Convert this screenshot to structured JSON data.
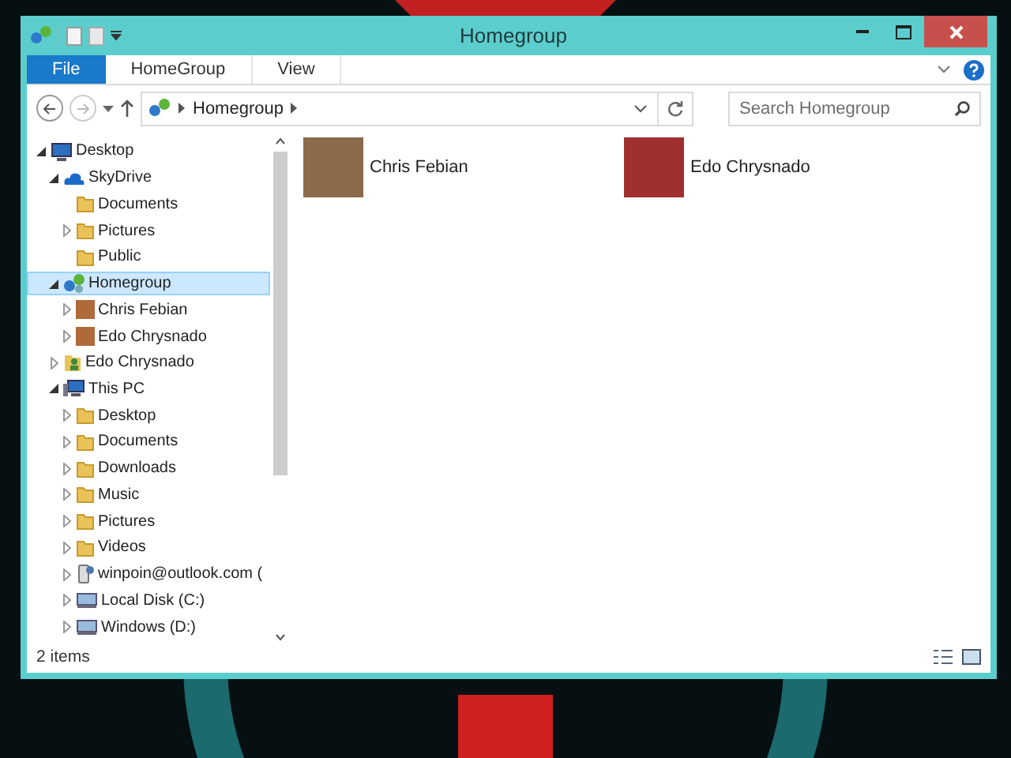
{
  "window": {
    "title": "Homegroup"
  },
  "ribbon": {
    "tabs": [
      {
        "label": "File",
        "kind": "file",
        "selected": false
      },
      {
        "label": "HomeGroup",
        "kind": "tab",
        "selected": false
      },
      {
        "label": "View",
        "kind": "tab",
        "selected": false
      }
    ]
  },
  "address": {
    "path": "Homegroup",
    "search_placeholder": "Search Homegroup"
  },
  "sidebar": {
    "items": [
      {
        "label": "Desktop",
        "kind": "desktop",
        "expandable": true,
        "expanded": true,
        "selected": false,
        "children": [
          {
            "label": "SkyDrive",
            "kind": "cloud",
            "expandable": true,
            "expanded": true,
            "selected": false,
            "children": [
              {
                "label": "Documents",
                "kind": "folder",
                "expandable": false,
                "selected": false
              },
              {
                "label": "Pictures",
                "kind": "folder",
                "expandable": true,
                "expanded": false,
                "selected": false
              },
              {
                "label": "Public",
                "kind": "folder",
                "expandable": false,
                "selected": false
              }
            ]
          },
          {
            "label": "Homegroup",
            "kind": "homegroup",
            "expandable": true,
            "expanded": true,
            "selected": true,
            "children": [
              {
                "label": "Chris Febian",
                "kind": "photo",
                "expandable": true,
                "expanded": false,
                "selected": false
              },
              {
                "label": "Edo Chrysnado",
                "kind": "photo",
                "expandable": true,
                "expanded": false,
                "selected": false
              }
            ]
          },
          {
            "label": "Edo Chrysnado",
            "kind": "user",
            "expandable": true,
            "expanded": false,
            "selected": false
          },
          {
            "label": "This PC",
            "kind": "pc",
            "expandable": true,
            "expanded": true,
            "selected": false,
            "children": [
              {
                "label": "Desktop",
                "kind": "folder",
                "expandable": true,
                "expanded": false,
                "selected": false
              },
              {
                "label": "Documents",
                "kind": "folder",
                "expandable": true,
                "expanded": false,
                "selected": false
              },
              {
                "label": "Downloads",
                "kind": "folder",
                "expandable": true,
                "expanded": false,
                "selected": false
              },
              {
                "label": "Music",
                "kind": "folder",
                "expandable": true,
                "expanded": false,
                "selected": false
              },
              {
                "label": "Pictures",
                "kind": "folder",
                "expandable": true,
                "expanded": false,
                "selected": false
              },
              {
                "label": "Videos",
                "kind": "folder",
                "expandable": true,
                "expanded": false,
                "selected": false
              },
              {
                "label": "winpoin@outlook.com (",
                "kind": "phone",
                "expandable": true,
                "expanded": false,
                "selected": false
              },
              {
                "label": "Local Disk (C:)",
                "kind": "drive",
                "expandable": true,
                "expanded": false,
                "selected": false
              },
              {
                "label": "Windows (D:)",
                "kind": "drive",
                "expandable": true,
                "expanded": false,
                "selected": false
              }
            ]
          }
        ]
      }
    ]
  },
  "content": {
    "items": [
      {
        "name": "Chris Febian"
      },
      {
        "name": "Edo Chrysnado"
      }
    ]
  },
  "status_bar": {
    "count": "2 items"
  }
}
